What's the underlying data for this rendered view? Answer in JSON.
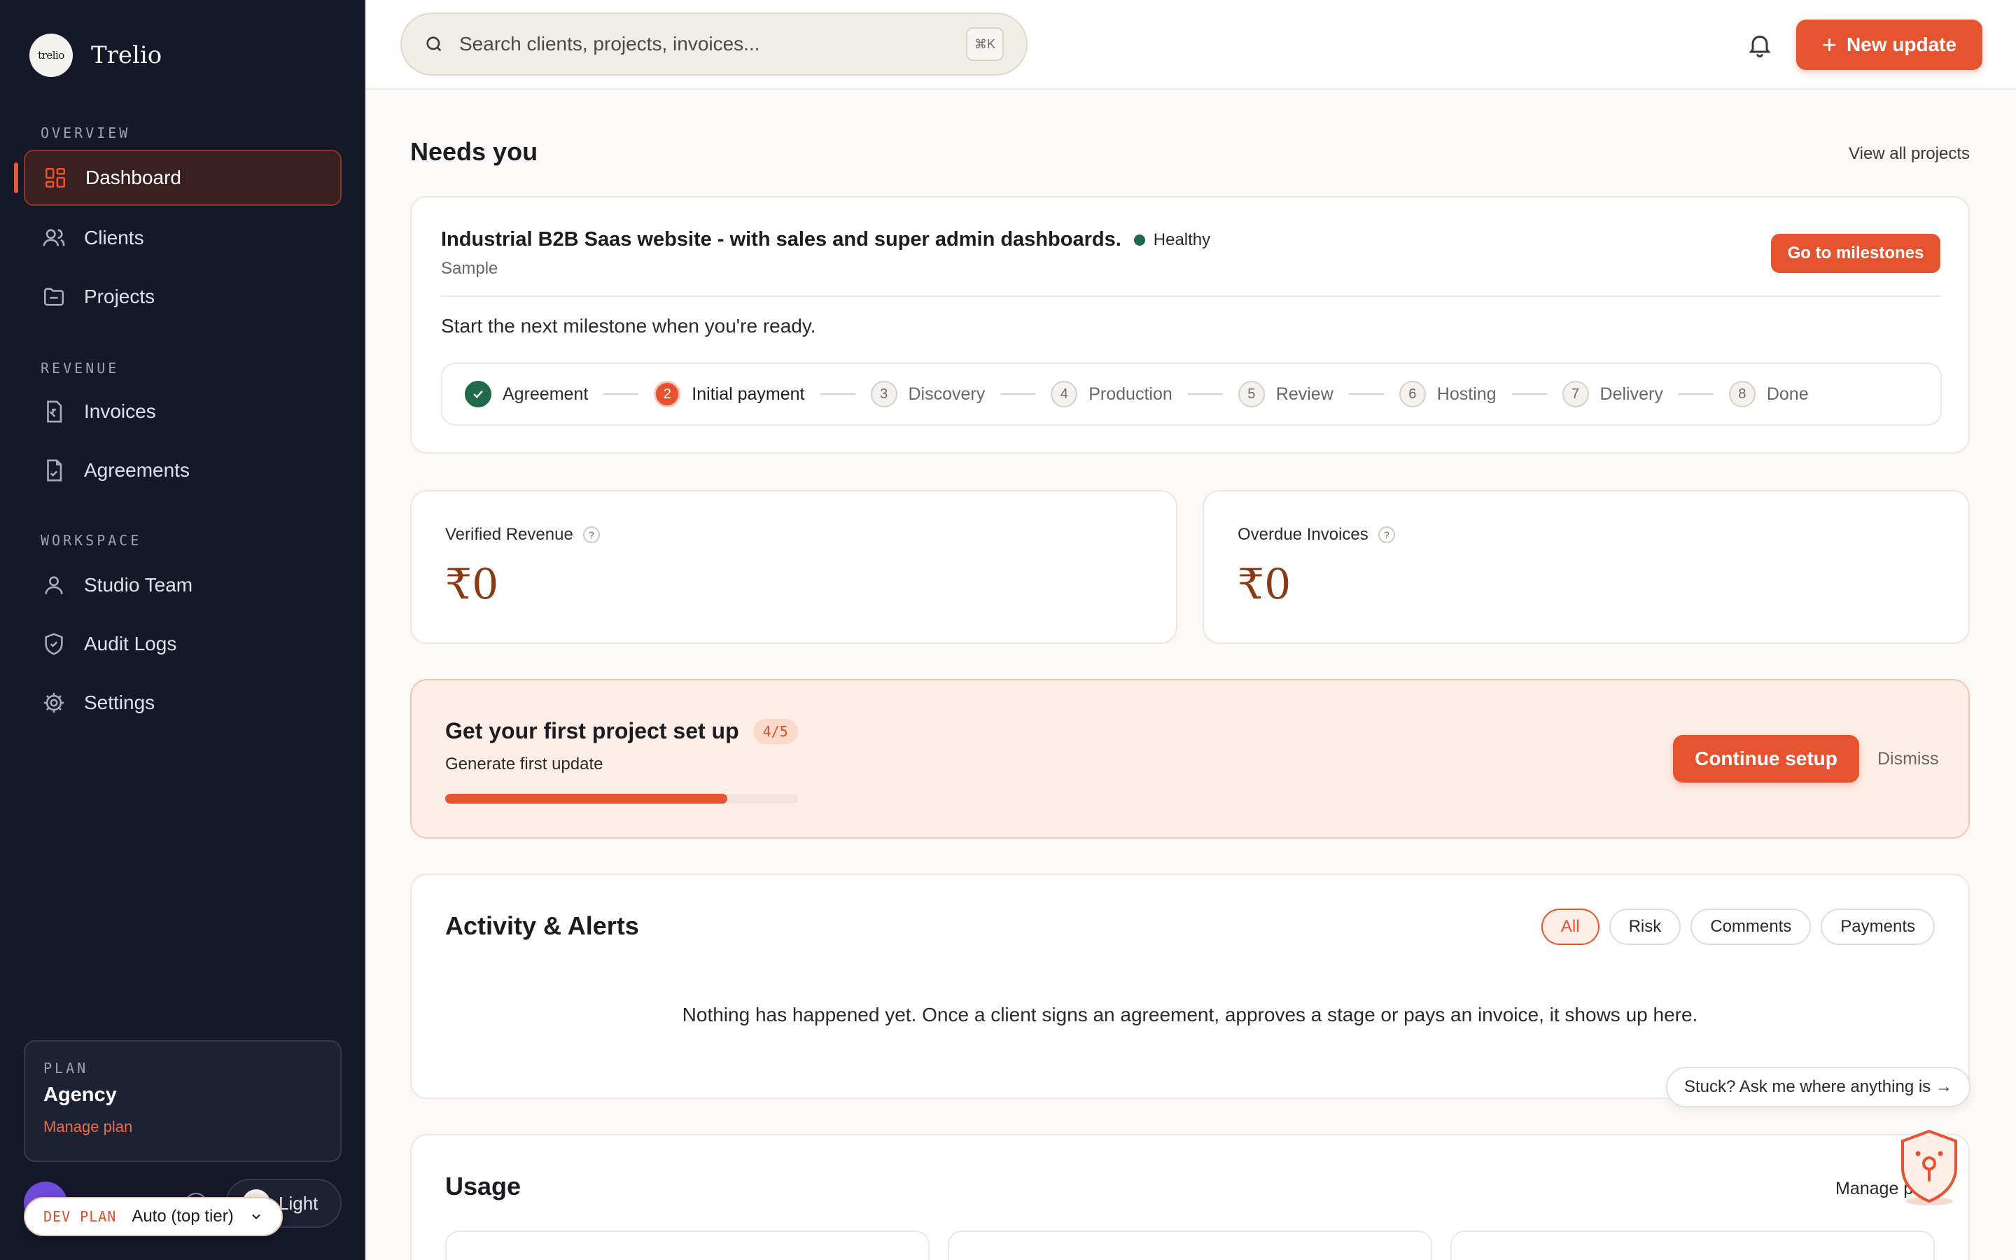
{
  "brand": {
    "logo_text": "trelio",
    "name": "Trelio"
  },
  "sidebar": {
    "sections": {
      "overview": "OVERVIEW",
      "revenue": "REVENUE",
      "workspace": "WORKSPACE"
    },
    "items": [
      {
        "label": "Dashboard",
        "icon": "grid-icon",
        "active": true
      },
      {
        "label": "Clients",
        "icon": "users-icon"
      },
      {
        "label": "Projects",
        "icon": "folder-icon"
      },
      {
        "label": "Invoices",
        "icon": "invoice-icon"
      },
      {
        "label": "Agreements",
        "icon": "document-icon"
      },
      {
        "label": "Studio Team",
        "icon": "user-icon"
      },
      {
        "label": "Audit Logs",
        "icon": "shield-icon"
      },
      {
        "label": "Settings",
        "icon": "gear-icon"
      }
    ],
    "plan": {
      "label": "PLAN",
      "name": "Agency",
      "manage": "Manage plan"
    },
    "theme_toggle": "Light",
    "dev_plan": {
      "tag": "DEV PLAN",
      "value": "Auto (top tier)"
    }
  },
  "topbar": {
    "search_placeholder": "Search clients, projects, invoices...",
    "shortcut": "⌘K",
    "new_update": "New update"
  },
  "needs_you": {
    "title": "Needs you",
    "view_all": "View all projects",
    "project": {
      "title": "Industrial B2B Saas website - with sales and super admin dashboards.",
      "status": "Healthy",
      "subtitle": "Sample",
      "cta": "Go to milestones",
      "next_text": "Start the next milestone when you're ready.",
      "steps": [
        {
          "num": "",
          "label": "Agreement",
          "state": "done"
        },
        {
          "num": "2",
          "label": "Initial payment",
          "state": "current"
        },
        {
          "num": "3",
          "label": "Discovery",
          "state": "pending"
        },
        {
          "num": "4",
          "label": "Production",
          "state": "pending"
        },
        {
          "num": "5",
          "label": "Review",
          "state": "pending"
        },
        {
          "num": "6",
          "label": "Hosting",
          "state": "pending"
        },
        {
          "num": "7",
          "label": "Delivery",
          "state": "pending"
        },
        {
          "num": "8",
          "label": "Done",
          "state": "pending"
        }
      ]
    }
  },
  "stats": {
    "verified_revenue": {
      "label": "Verified Revenue",
      "value": "₹0"
    },
    "overdue_invoices": {
      "label": "Overdue Invoices",
      "value": "₹0"
    }
  },
  "setup": {
    "title": "Get your first project set up",
    "badge": "4/5",
    "subtitle": "Generate first update",
    "progress": 0.8,
    "cta": "Continue setup",
    "dismiss": "Dismiss"
  },
  "activity": {
    "title": "Activity & Alerts",
    "filters": [
      "All",
      "Risk",
      "Comments",
      "Payments"
    ],
    "active_filter": "All",
    "empty": "Nothing has happened yet. Once a client signs an agreement, approves a stage or pays an invoice, it shows up here."
  },
  "assistant": {
    "prompt": "Stuck? Ask me where anything is →"
  },
  "usage": {
    "title": "Usage",
    "manage": "Manage p"
  },
  "colors": {
    "accent": "#e5532f",
    "sidebar_bg": "#141828",
    "healthy": "#1f6a4a"
  }
}
